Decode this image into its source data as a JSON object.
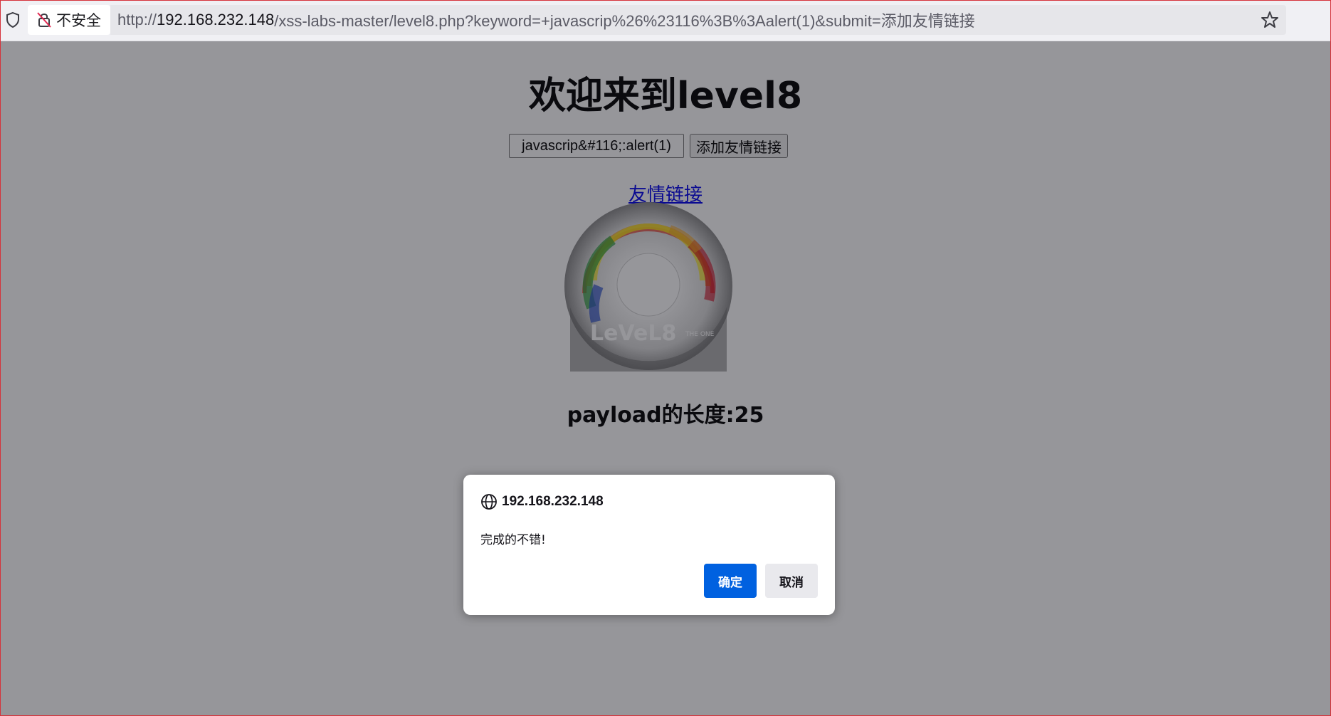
{
  "browser": {
    "security_label": "不安全",
    "url_scheme": "http://",
    "url_host": "192.168.232.148",
    "url_path": "/xss-labs-master/level8.php?keyword=+javascrip%26%23116%3B%3Aalert(1)&submit=添加友情链接"
  },
  "page": {
    "title": "欢迎来到level8",
    "keyword_value": "javascrip&#116;:alert(1)",
    "submit_label": "添加友情链接",
    "link_text": "友情链接",
    "disc_text": "LeVeL8",
    "disc_badge": "THE ONE",
    "payload_length": "payload的长度:25"
  },
  "dialog": {
    "origin": "192.168.232.148",
    "message": "完成的不错!",
    "ok_label": "确定",
    "cancel_label": "取消"
  },
  "colors": {
    "overlay": "#16161e",
    "dialog_primary": "#0061e0",
    "link": "#0000ee"
  }
}
